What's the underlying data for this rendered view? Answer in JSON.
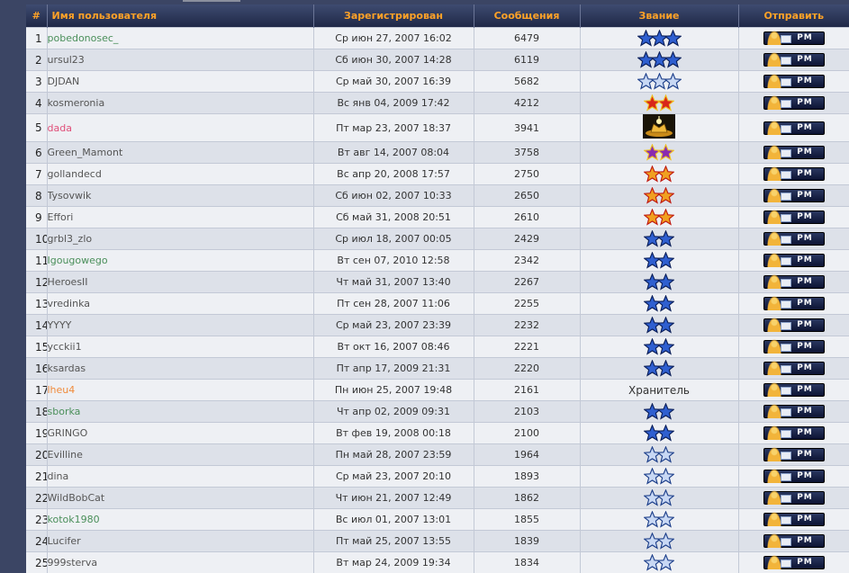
{
  "headers": {
    "num": "#",
    "name": "Имя пользователя",
    "registered": "Зарегистрирован",
    "posts": "Сообщения",
    "rank": "Звание",
    "send": "Отправить"
  },
  "pm_label": "PM",
  "colors": {
    "star_blue": "#2f5fd0",
    "star_light": "#c8d8f4",
    "star_red": "#d8261a",
    "star_gold": "#f0a020",
    "star_purple": "#8a2bb0",
    "name_green": "#4a8f5a",
    "name_pink": "#e0507a",
    "name_orange": "#f08a3a"
  },
  "rows": [
    {
      "num": "1",
      "name": "pobedonosec_",
      "name_color": "#4a8f5a",
      "registered": "Ср июн 27, 2007 16:02",
      "posts": "6479",
      "rank_icon": "three-blue-stars-icon"
    },
    {
      "num": "2",
      "name": "ursul23",
      "name_color": "#555555",
      "registered": "Сб июн 30, 2007 14:28",
      "posts": "6119",
      "rank_icon": "three-blue-stars-icon"
    },
    {
      "num": "3",
      "name": "DJDAN",
      "name_color": "#555555",
      "registered": "Ср май 30, 2007 16:39",
      "posts": "5682",
      "rank_icon": "three-light-stars-icon"
    },
    {
      "num": "4",
      "name": "kosmeronia",
      "name_color": "#555555",
      "registered": "Вс янв 04, 2009 17:42",
      "posts": "4212",
      "rank_icon": "two-red-stars-icon"
    },
    {
      "num": "5",
      "name": "dada",
      "name_color": "#e0507a",
      "registered": "Пт мар 23, 2007 18:37",
      "posts": "3941",
      "rank_icon": "golden-crown-icon"
    },
    {
      "num": "6",
      "name": "Green_Mamont",
      "name_color": "#555555",
      "registered": "Вт авг 14, 2007 08:04",
      "posts": "3758",
      "rank_icon": "two-purple-stars-icon"
    },
    {
      "num": "7",
      "name": "gollandecd",
      "name_color": "#555555",
      "registered": "Вс апр 20, 2008 17:57",
      "posts": "2750",
      "rank_icon": "two-gold-stars-icon"
    },
    {
      "num": "8",
      "name": "Tysovwik",
      "name_color": "#555555",
      "registered": "Сб июн 02, 2007 10:33",
      "posts": "2650",
      "rank_icon": "two-gold-stars-icon"
    },
    {
      "num": "9",
      "name": "Effori",
      "name_color": "#555555",
      "registered": "Сб май 31, 2008 20:51",
      "posts": "2610",
      "rank_icon": "two-gold-stars-icon"
    },
    {
      "num": "10",
      "name": "grbl3_zlo",
      "name_color": "#555555",
      "registered": "Ср июл 18, 2007 00:05",
      "posts": "2429",
      "rank_icon": "two-blue-stars-icon"
    },
    {
      "num": "11",
      "name": "Igougowego",
      "name_color": "#4a8f5a",
      "registered": "Вт сен 07, 2010 12:58",
      "posts": "2342",
      "rank_icon": "two-blue-stars-icon"
    },
    {
      "num": "12",
      "name": "HeroesII",
      "name_color": "#555555",
      "registered": "Чт май 31, 2007 13:40",
      "posts": "2267",
      "rank_icon": "two-blue-stars-icon"
    },
    {
      "num": "13",
      "name": "vredinka",
      "name_color": "#555555",
      "registered": "Пт сен 28, 2007 11:06",
      "posts": "2255",
      "rank_icon": "two-blue-stars-icon"
    },
    {
      "num": "14",
      "name": "YYYY",
      "name_color": "#555555",
      "registered": "Ср май 23, 2007 23:39",
      "posts": "2232",
      "rank_icon": "two-blue-stars-icon"
    },
    {
      "num": "15",
      "name": "ycckii1",
      "name_color": "#555555",
      "registered": "Вт окт 16, 2007 08:46",
      "posts": "2221",
      "rank_icon": "two-blue-stars-icon"
    },
    {
      "num": "16",
      "name": "ksardas",
      "name_color": "#555555",
      "registered": "Пт апр 17, 2009 21:31",
      "posts": "2220",
      "rank_icon": "two-blue-stars-icon"
    },
    {
      "num": "17",
      "name": "lheu4",
      "name_color": "#f08a3a",
      "registered": "Пн июн 25, 2007 19:48",
      "posts": "2161",
      "rank_text": "Хранитель"
    },
    {
      "num": "18",
      "name": "sborka",
      "name_color": "#4a8f5a",
      "registered": "Чт апр 02, 2009 09:31",
      "posts": "2103",
      "rank_icon": "two-blue-stars-icon"
    },
    {
      "num": "19",
      "name": "GRINGO",
      "name_color": "#555555",
      "registered": "Вт фев 19, 2008 00:18",
      "posts": "2100",
      "rank_icon": "two-blue-stars-icon"
    },
    {
      "num": "20",
      "name": "Evilline",
      "name_color": "#555555",
      "registered": "Пн май 28, 2007 23:59",
      "posts": "1964",
      "rank_icon": "two-light-stars-icon"
    },
    {
      "num": "21",
      "name": "dina",
      "name_color": "#555555",
      "registered": "Ср май 23, 2007 20:10",
      "posts": "1893",
      "rank_icon": "two-light-stars-icon"
    },
    {
      "num": "22",
      "name": "WildBobCat",
      "name_color": "#555555",
      "registered": "Чт июн 21, 2007 12:49",
      "posts": "1862",
      "rank_icon": "two-light-stars-icon"
    },
    {
      "num": "23",
      "name": "kotok1980",
      "name_color": "#4a8f5a",
      "registered": "Вс июл 01, 2007 13:01",
      "posts": "1855",
      "rank_icon": "two-light-stars-icon"
    },
    {
      "num": "24",
      "name": "Lucifer",
      "name_color": "#555555",
      "registered": "Пт май 25, 2007 13:55",
      "posts": "1839",
      "rank_icon": "two-light-stars-icon"
    },
    {
      "num": "25",
      "name": "999sterva",
      "name_color": "#555555",
      "registered": "Вт мар 24, 2009 19:34",
      "posts": "1834",
      "rank_icon": "two-light-stars-icon"
    }
  ]
}
